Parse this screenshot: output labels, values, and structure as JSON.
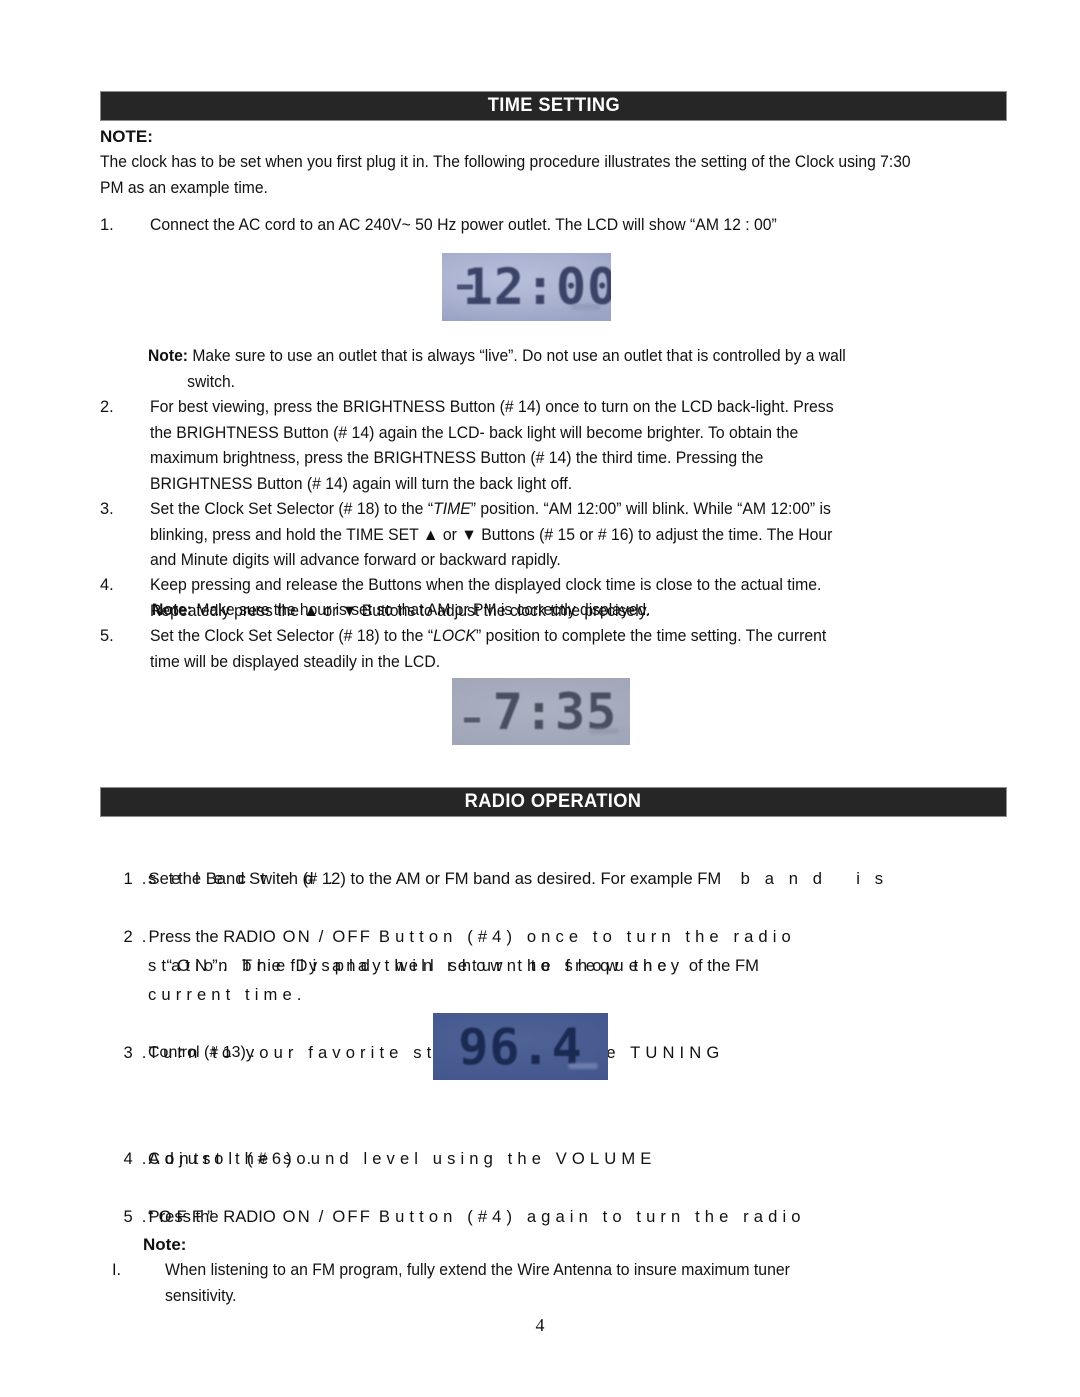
{
  "document": {
    "page_number": "4"
  },
  "sections": [
    {
      "id": "time-setting",
      "title": "TIME SETTING"
    },
    {
      "id": "radio-operation",
      "title": "RADIO OPERATION"
    }
  ],
  "time_setting": {
    "note_heading": "NOTE:",
    "note_body": "The clock has to be set when you first plug it in. The following procedure illustrates the setting of the Clock using 7:30\nPM as an example time.",
    "steps": [
      {
        "number": "1.",
        "text": "Connect the AC cord to an AC 240V~ 50 Hz power outlet. The LCD will show “AM 12 : 00”"
      },
      {
        "number": "2.",
        "text": "For best viewing, press the BRIGHTNESS Button (# 14) once to turn on the LCD back-light. Press\nthe BRIGHTNESS Button (# 14) again the LCD- back light will become brighter. To obtain the\nmaximum brightness, press the BRIGHTNESS Button (# 14) the third time. Pressing the\nBRIGHTNESS Button (# 14) again will turn the back light off."
      },
      {
        "number": "3.",
        "text_pre": "Set the Clock Set Selector (# 18) to the “",
        "emphasis": "TIME",
        "text_post": "” position. “AM 12:00” will blink. While “AM 12:00” is\nblinking, press and hold the TIME SET ▲ or ▼ Buttons (# 15 or # 16) to adjust the time. The Hour\nand Minute digits will advance forward or backward rapidly."
      },
      {
        "number": "4.",
        "text": "Keep pressing and release the Buttons when the displayed clock time is close to the actual time.\nRepeatedly press the ▲ or ▼ Buttons to adjust the clock time precisely.",
        "sub_note_label": "Note:",
        "sub_note_text": " Make sure the hour is set so that AM or PM is correctly displayed."
      },
      {
        "number": "5.",
        "text_pre": "Set the Clock Set Selector (# 18) to the “",
        "emphasis": "LOCK",
        "text_post": "” position to complete the time setting. The current\ntime will be displayed steadily in the LCD."
      }
    ],
    "inline_note": {
      "label": "Note:",
      "text": " Make sure to use an outlet that is always “live”. Do not use an outlet that is controlled by a wall\n         switch."
    }
  },
  "lcd_displays": [
    {
      "id": "lcd-clock-1200",
      "reading": "12:00",
      "indicator": "AM",
      "caption": "clock showing AM 12:00"
    },
    {
      "id": "lcd-clock-735",
      "reading": "7:35",
      "indicator": "PM",
      "caption": "clock showing 7:35"
    },
    {
      "id": "lcd-frequency-964",
      "reading": "96.4",
      "indicator": "",
      "caption": "display showing FM frequency 96.4"
    }
  ],
  "radio_operation": {
    "steps": [
      {
        "number": "1 .",
        "line1_tight": "Set the Band Switch (# 12) to the AM or FM band as desired. For example FM",
        "line1_spaced": "  b a n d   i s",
        "line2_spaced": "s e l e c t e d ."
      },
      {
        "number": "2 .",
        "line1_tight": "Press the RADIO",
        "line1_spaced": " ON / OFF ",
        "line1_tight2": "Button (#4)",
        "line1_spaced2": " once to turn the radio",
        "line2_spaced": "“ON”. The Display will show the frequency",
        "line2_tight": " of the FM",
        "line3_spaced": "station briefly and then return to show the",
        "line4_spaced": "current time."
      },
      {
        "number": "3 .",
        "line1_spaced": "Turn to your favorite station using the TUNING",
        "line2_tight": "Control (# 13) ."
      },
      {
        "number": "4 .",
        "line1_spaced": "Adjust the sound level using the VOLUME",
        "line2_spaced": "Control (#6) ."
      },
      {
        "number": "5 .",
        "line1_tight": "Press the RADIO",
        "line1_spaced": " ON / OFF ",
        "line1_tight2": "Button (#4)",
        "line1_spaced2": " again to turn the radio",
        "line2_spaced": "“OFF”"
      }
    ],
    "final_note": {
      "heading": "Note:",
      "item_marker": "I.",
      "item_text": "When listening to an FM program, fully extend the Wire Antenna to insure maximum tuner\nsensitivity."
    }
  },
  "colors": {
    "header_bar": "#262626",
    "header_text": "#ffffff",
    "body_text": "#111111",
    "lcd_blue": "#4f6396",
    "lcd_gray": "#a9b1cf"
  }
}
